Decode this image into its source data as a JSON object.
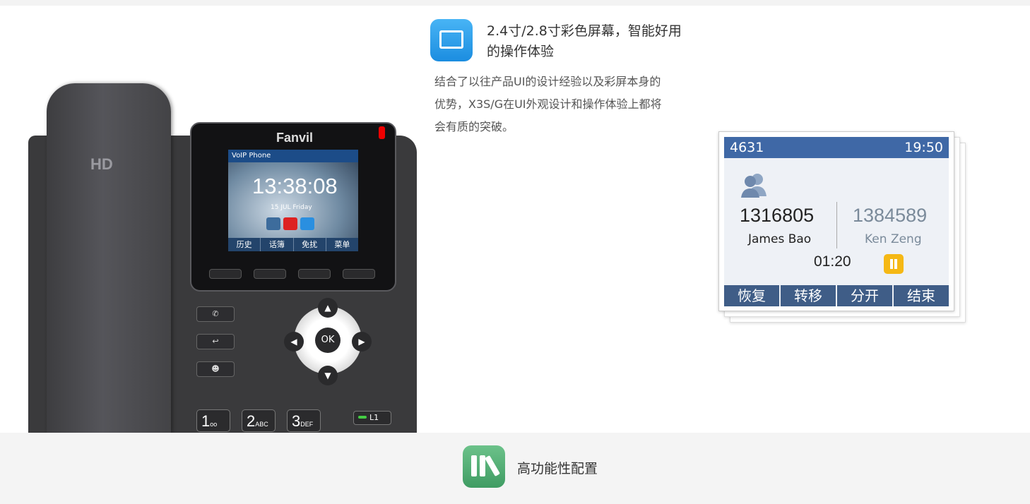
{
  "feature1": {
    "title_line1": "2.4寸/2.8寸彩色屏幕，智能好用",
    "title_line2": "的操作体验",
    "desc_line1": "结合了以往产品UI的设计经验以及彩屏本身的",
    "desc_line2": "优势，X3S/G在UI外观设计和操作体验上都将",
    "desc_line3": "会有质的突破。",
    "icon": "picture-icon"
  },
  "phone": {
    "badge": "HD",
    "brand": "Fanvil",
    "lcd_title": "VoIP Phone",
    "lcd_time": "13:38:08",
    "lcd_date": "15 JUL Friday",
    "softkeys": [
      "历史",
      "话簿",
      "免扰",
      "菜单"
    ],
    "ok_label": "OK",
    "keys": [
      {
        "digit": "1",
        "sub": "oo"
      },
      {
        "digit": "2",
        "sub": "ABC"
      },
      {
        "digit": "3",
        "sub": "DEF"
      }
    ],
    "line_key": "L1"
  },
  "call_card": {
    "ext": "4631",
    "clock": "19:50",
    "number1": "1316805",
    "name1": "James Bao",
    "number2": "1384589",
    "name2": "Ken Zeng",
    "duration": "01:20",
    "softkeys": [
      "恢复",
      "转移",
      "分开",
      "结束"
    ]
  },
  "feature2": {
    "title": "高功能性配置",
    "icon": "binders-icon"
  },
  "colors": {
    "accent_blue": "#1b8de0",
    "card_bar": "#3f68a6",
    "green_icon": "#3f9c63",
    "pause_yellow": "#f5b815"
  }
}
